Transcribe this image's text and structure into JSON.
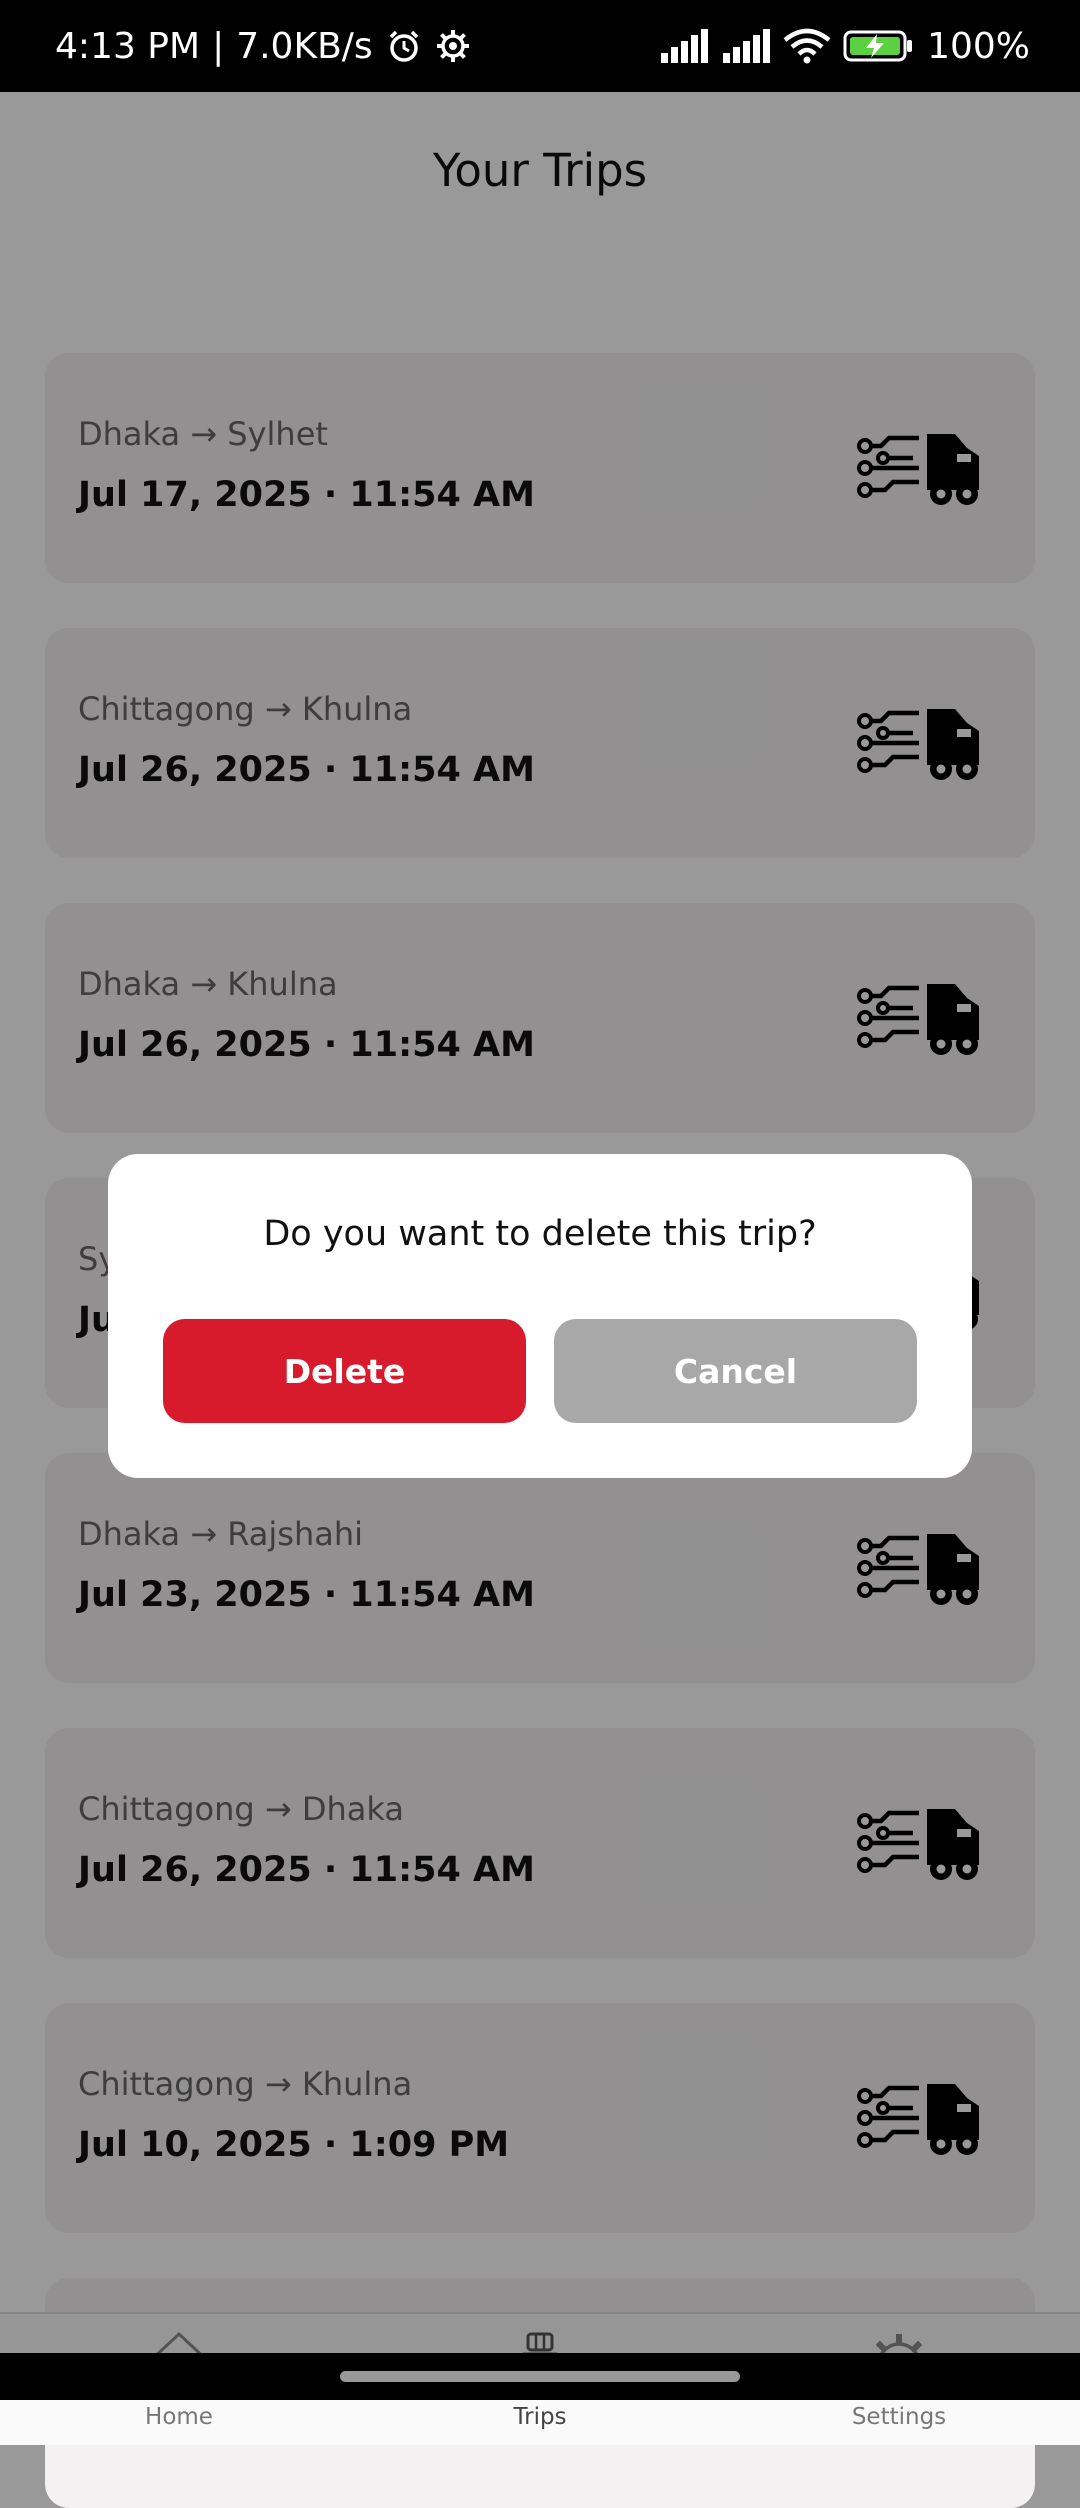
{
  "status_bar": {
    "time": "4:13 PM",
    "network_speed": "7.0KB/s",
    "battery": "100%",
    "icons": [
      "alarm-icon",
      "settings-icon",
      "signal-icon",
      "signal-icon",
      "wifi-icon",
      "battery-charging-icon"
    ]
  },
  "page": {
    "title": "Your Trips"
  },
  "trips": [
    {
      "route": "Dhaka → Sylhet",
      "date": "Jul 17, 2025 · 11:54 AM"
    },
    {
      "route": "Chittagong → Khulna",
      "date": "Jul 26, 2025 · 11:54 AM"
    },
    {
      "route": "Dhaka → Khulna",
      "date": "Jul 26, 2025 · 11:54 AM"
    },
    {
      "route": "Sy",
      "date": "Ju"
    },
    {
      "route": "Dhaka → Rajshahi",
      "date": "Jul 23, 2025 · 11:54 AM"
    },
    {
      "route": "Chittagong → Dhaka",
      "date": "Jul 26, 2025 · 11:54 AM"
    },
    {
      "route": "Chittagong → Khulna",
      "date": "Jul 10, 2025 · 1:09 PM"
    }
  ],
  "dialog": {
    "message": "Do you want to delete this trip?",
    "delete_label": "Delete",
    "cancel_label": "Cancel"
  },
  "bottom_nav": {
    "items": [
      {
        "label": "Home",
        "icon": "home-icon"
      },
      {
        "label": "Trips",
        "icon": "car-luggage-icon"
      },
      {
        "label": "Settings",
        "icon": "gear-icon"
      }
    ],
    "active": "Trips"
  },
  "colors": {
    "delete": "#d71b2c",
    "cancel": "#a8a8a8",
    "card": "#f3f1f1"
  }
}
